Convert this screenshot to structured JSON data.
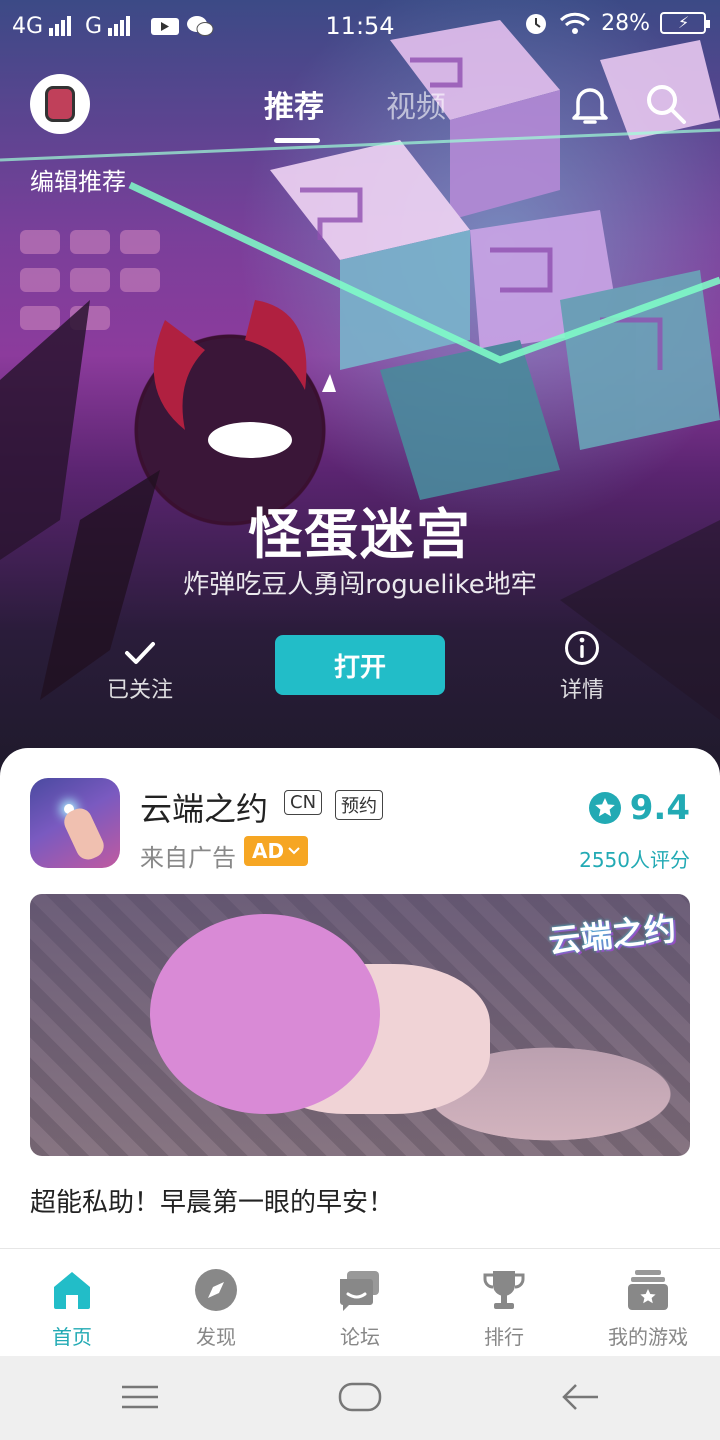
{
  "status_bar": {
    "network_1": "4G",
    "network_2": "G",
    "time": "11:54",
    "battery": "28%"
  },
  "header": {
    "tabs": [
      {
        "label": "推荐",
        "active": true
      },
      {
        "label": "视频",
        "active": false
      }
    ],
    "edit_recommend": "编辑推荐"
  },
  "hero": {
    "title": "怪蛋迷宫",
    "subtitle": "炸弹吃豆人勇闯roguelike地牢",
    "follow_label": "已关注",
    "open_label": "打开",
    "detail_label": "详情"
  },
  "ad_card": {
    "app_name": "云端之约",
    "tags": [
      "CN",
      "预约"
    ],
    "ad_source": "来自广告",
    "ad_badge": "AD",
    "rating": "9.4",
    "rating_count": "2550人评分",
    "banner_logo": "云端之约",
    "caption": "超能私助！早晨第一眼的早安！"
  },
  "bottom_nav": [
    {
      "label": "首页",
      "icon": "home-icon",
      "active": true
    },
    {
      "label": "发现",
      "icon": "compass-icon",
      "active": false
    },
    {
      "label": "论坛",
      "icon": "forum-icon",
      "active": false
    },
    {
      "label": "排行",
      "icon": "trophy-icon",
      "active": false
    },
    {
      "label": "我的游戏",
      "icon": "my-games-icon",
      "active": false
    }
  ],
  "colors": {
    "accent": "#22bdc8",
    "accent_text": "#22aab4",
    "ad_badge": "#f6a623"
  }
}
